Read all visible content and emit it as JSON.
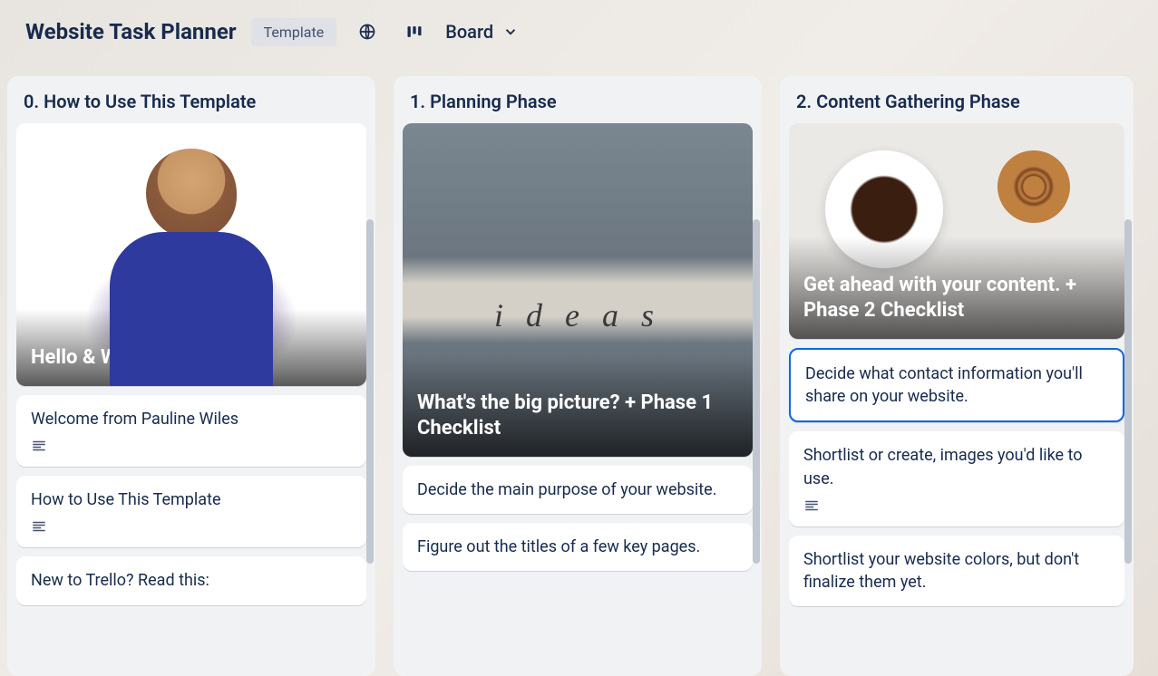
{
  "header": {
    "title": "Website Task Planner",
    "template_badge": "Template",
    "view_label": "Board"
  },
  "lists": [
    {
      "title": "0. How to Use This Template",
      "cover_card": {
        "title": "Hello & Welcome"
      },
      "cards": [
        {
          "title": "Welcome from Pauline Wiles",
          "has_description": true
        },
        {
          "title": "How to Use This Template",
          "has_description": true
        },
        {
          "title": "New to Trello? Read this:",
          "has_description": false
        }
      ]
    },
    {
      "title": "1. Planning Phase",
      "cover_card": {
        "title": "What's the big picture? + Phase 1 Checklist"
      },
      "cards": [
        {
          "title": "Decide the main purpose of your website.",
          "has_description": false
        },
        {
          "title": "Figure out the titles of a few key pages.",
          "has_description": false
        }
      ]
    },
    {
      "title": "2. Content Gathering Phase",
      "cover_card": {
        "title": "Get ahead with your content. + Phase 2 Checklist"
      },
      "cards": [
        {
          "title": "Decide what contact information you'll share on your website.",
          "has_description": false,
          "selected": true
        },
        {
          "title": "Shortlist or create, images you'd like to use.",
          "has_description": true
        },
        {
          "title": "Shortlist your website colors, but don't finalize them yet.",
          "has_description": false
        }
      ]
    }
  ]
}
